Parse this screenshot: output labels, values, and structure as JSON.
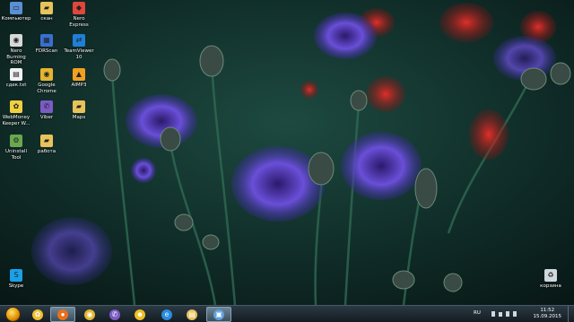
{
  "desktop": {
    "icons": [
      {
        "label": "Компьютер",
        "icon": "computer-icon",
        "color": "#5b8fd6"
      },
      {
        "label": "скан",
        "icon": "folder-icon",
        "color": "#e8c25a"
      },
      {
        "label": "Nero Express",
        "icon": "nero-express-icon",
        "color": "#e0463a"
      },
      {
        "label": "Nero Burning ROM",
        "icon": "nero-burning-rom-icon",
        "color": "#d8d8d8"
      },
      {
        "label": "FDRScan",
        "icon": "fdrscan-icon",
        "color": "#3a6fd0"
      },
      {
        "label": "TeamViewer 10",
        "icon": "teamviewer-icon",
        "color": "#1e7fd8"
      },
      {
        "label": "сдек.txt",
        "icon": "text-file-icon",
        "color": "#f2f2f2"
      },
      {
        "label": "Google Chrome",
        "icon": "chrome-icon",
        "color": "#e4b530"
      },
      {
        "label": "AIMP3",
        "icon": "aimp-icon",
        "color": "#f0a020"
      },
      {
        "label": "WebMoney Keeper W...",
        "icon": "webmoney-icon",
        "color": "#f0d040"
      },
      {
        "label": "Viber",
        "icon": "viber-icon",
        "color": "#7b5bc4"
      },
      {
        "label": "Maps",
        "icon": "folder-icon",
        "color": "#e8c25a"
      },
      {
        "label": "Uninstall Tool",
        "icon": "uninstall-tool-icon",
        "color": "#6aa84f"
      },
      {
        "label": "работа",
        "icon": "folder-icon",
        "color": "#e8c25a"
      },
      {
        "label": "Skype",
        "icon": "skype-icon",
        "color": "#1aa0e8"
      },
      {
        "label": "корзина",
        "icon": "recycle-bin-icon",
        "color": "#cfd8de"
      }
    ]
  },
  "taskbar": {
    "start_icon": "windows-start-orb-icon",
    "pinned": [
      {
        "icon": "webmoney-taskbar-icon",
        "color": "#f0c030",
        "glyph": "✿",
        "active": false
      },
      {
        "icon": "firefox-icon",
        "color": "#e8701a",
        "glyph": "●",
        "active": true
      },
      {
        "icon": "chrome-taskbar-icon",
        "color": "#e4b530",
        "glyph": "◉",
        "active": false
      },
      {
        "icon": "viber-taskbar-icon",
        "color": "#7b5bc4",
        "glyph": "✆",
        "active": false
      },
      {
        "icon": "messenger-icon",
        "color": "#f0c020",
        "glyph": "☻",
        "active": false
      },
      {
        "icon": "internet-explorer-icon",
        "color": "#2a8be0",
        "glyph": "e",
        "active": false
      },
      {
        "icon": "file-explorer-icon",
        "color": "#e8c25a",
        "glyph": "▤",
        "active": false
      },
      {
        "icon": "remote-desktop-icon",
        "color": "#5fa0e0",
        "glyph": "▣",
        "active": true
      }
    ],
    "tray": {
      "language": "RU",
      "time": "11:52",
      "date": "15.09.2015"
    }
  }
}
